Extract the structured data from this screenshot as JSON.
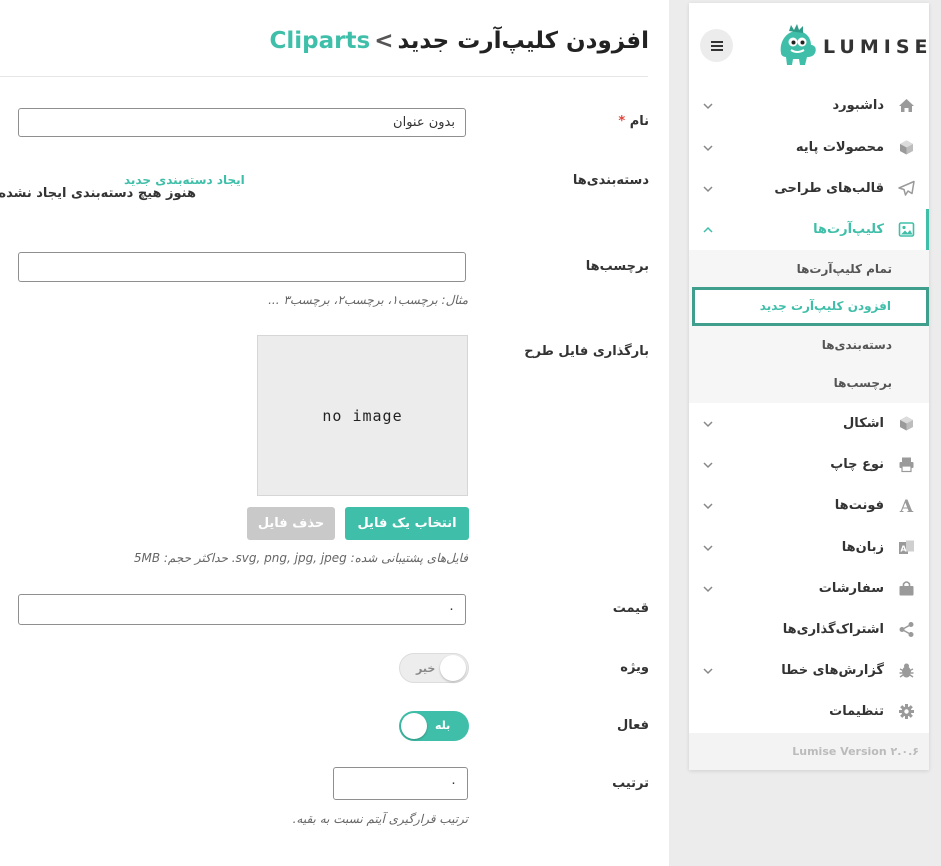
{
  "header": {
    "crumb": "Cliparts",
    "separator": "<",
    "title": "افزودن کلیپ‌آرت جدید"
  },
  "form": {
    "name": {
      "label": "نام",
      "required_mark": "*",
      "value": "بدون عنوان"
    },
    "categories": {
      "label": "دسته‌بندی‌ها",
      "empty_text": "هنوز هیچ دسته‌بندی ایجاد نشده است.",
      "create_link": "ایجاد دسته‌بندی جدید"
    },
    "tags": {
      "label": "برچسب‌ها",
      "value": "",
      "hint": "مثال: برچسب۱، برچسب۲، برچسب۳ ..."
    },
    "upload": {
      "label": "بارگذاری فایل طرح",
      "placeholder_text": "no image",
      "select_button": "انتخاب یک فایل",
      "remove_button": "حذف فایل",
      "hint": "فایل‌های پشتیبانی شده: svg, png, jpg, jpeg. حداکثر حجم: 5MB"
    },
    "price": {
      "label": "قیمت",
      "value": "۰"
    },
    "featured": {
      "label": "ویژه",
      "state_text": "خیر",
      "on": false
    },
    "active": {
      "label": "فعال",
      "state_text": "بله",
      "on": true
    },
    "order": {
      "label": "ترتیب",
      "value": "۰",
      "hint": "ترتیب قرارگیری آیتم نسبت به بقیه."
    }
  },
  "sidebar": {
    "logo_text": "LUMISE",
    "menu_icon": "hamburger-icon",
    "items": [
      {
        "label": "داشبورد",
        "icon": "home-icon",
        "has_chevron": true
      },
      {
        "label": "محصولات پایه",
        "icon": "cube-icon",
        "has_chevron": true
      },
      {
        "label": "قالب‌های طراحی",
        "icon": "paper-plane-icon",
        "has_chevron": true
      },
      {
        "label": "کلیپ‌آرت‌ها",
        "icon": "image-icon",
        "has_chevron": true,
        "active": true
      },
      {
        "label": "اشکال",
        "icon": "cube-icon",
        "has_chevron": true
      },
      {
        "label": "نوع چاپ",
        "icon": "printer-icon",
        "has_chevron": true
      },
      {
        "label": "فونت‌ها",
        "icon": "font-icon",
        "has_chevron": true
      },
      {
        "label": "زبان‌ها",
        "icon": "language-icon",
        "has_chevron": true
      },
      {
        "label": "سفارشات",
        "icon": "shopping-bag-icon",
        "has_chevron": true
      },
      {
        "label": "اشتراک‌گذاری‌ها",
        "icon": "share-icon",
        "has_chevron": false
      },
      {
        "label": "گزارش‌های خطا",
        "icon": "bug-icon",
        "has_chevron": true
      },
      {
        "label": "تنظیمات",
        "icon": "gear-icon",
        "has_chevron": false
      }
    ],
    "submenu": [
      {
        "label": "تمام کلیپ‌آرت‌ها"
      },
      {
        "label": "افزودن کلیپ‌آرت جدید",
        "current": true
      },
      {
        "label": "دسته‌بندی‌ها"
      },
      {
        "label": "برچسب‌ها"
      }
    ],
    "version": "Lumise Version ۲.۰.۶"
  },
  "colors": {
    "accent": "#3fbfa9",
    "highlight_border": "#3f9e8c",
    "required": "#e0443b"
  }
}
